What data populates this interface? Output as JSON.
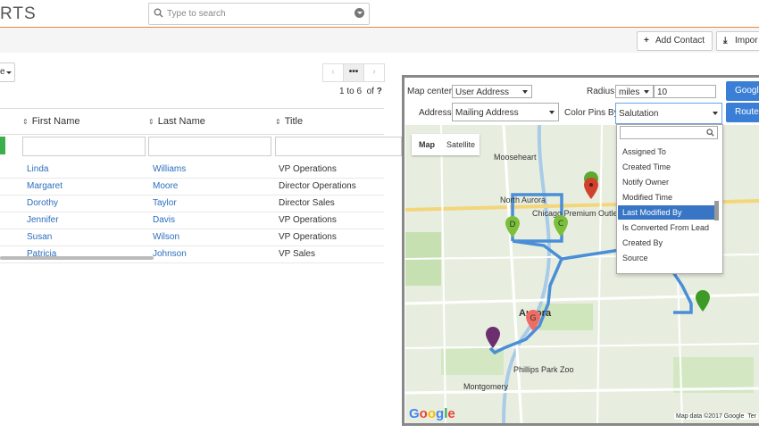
{
  "app": {
    "logo_partial": "RTS"
  },
  "search": {
    "placeholder": "Type to search"
  },
  "toolbar": {
    "add_contact": "Add Contact",
    "import": "Impor"
  },
  "list": {
    "view_selector_partial": "e",
    "pagination": {
      "prev": "‹",
      "more": "•••",
      "next": "›"
    },
    "page_info_prefix": "1 to 6",
    "page_info_of": "of",
    "page_info_total": "?",
    "columns": {
      "first_name": "First Name",
      "last_name": "Last Name",
      "title": "Title"
    },
    "rows": [
      {
        "first": "Linda",
        "last": "Williams",
        "title": "VP Operations"
      },
      {
        "first": "Margaret",
        "last": "Moore",
        "title": "Director Operations"
      },
      {
        "first": "Dorothy",
        "last": "Taylor",
        "title": "Director Sales"
      },
      {
        "first": "Jennifer",
        "last": "Davis",
        "title": "VP Operations"
      },
      {
        "first": "Susan",
        "last": "Wilson",
        "title": "VP Operations"
      },
      {
        "first": "Patricia",
        "last": "Johnson",
        "title": "VP Sales"
      }
    ]
  },
  "map_modal": {
    "map_center_label": "Map center:",
    "map_center_value": "User Address",
    "radius_label": "Radius:",
    "radius_unit": "miles",
    "radius_value": "10",
    "google_button": "Google",
    "address_label": "Address:",
    "address_value": "Mailing Address",
    "color_pins_label": "Color Pins By:",
    "color_pins_value": "Salutation",
    "route_button": "Route",
    "map_tab": "Map",
    "satellite_tab": "Satellite",
    "google_logo": "Google",
    "map_data": "Map data ©2017 Google",
    "terms_partial": "Ter",
    "places": {
      "mooseheart": "Mooseheart",
      "north_aurora": "North Aurora",
      "outlets": "Chicago Premium Outlets",
      "aurora": "Aurora",
      "zoo": "Phillips Park Zoo",
      "montgomery": "Montgomery"
    },
    "pins": {
      "d": "D",
      "c": "C",
      "g": "G"
    },
    "dropdown_options": [
      "Assigned To",
      "Created Time",
      "Notify Owner",
      "Modified Time",
      "Last Modified By",
      "Is Converted From Lead",
      "Created By",
      "Source"
    ],
    "dropdown_selected_index": 4
  },
  "colors": {
    "accent_orange": "#e88a3a",
    "primary_blue": "#3a7fd5",
    "highlight_blue": "#3876c5",
    "link": "#2a6ebb",
    "green": "#3cae4a"
  }
}
